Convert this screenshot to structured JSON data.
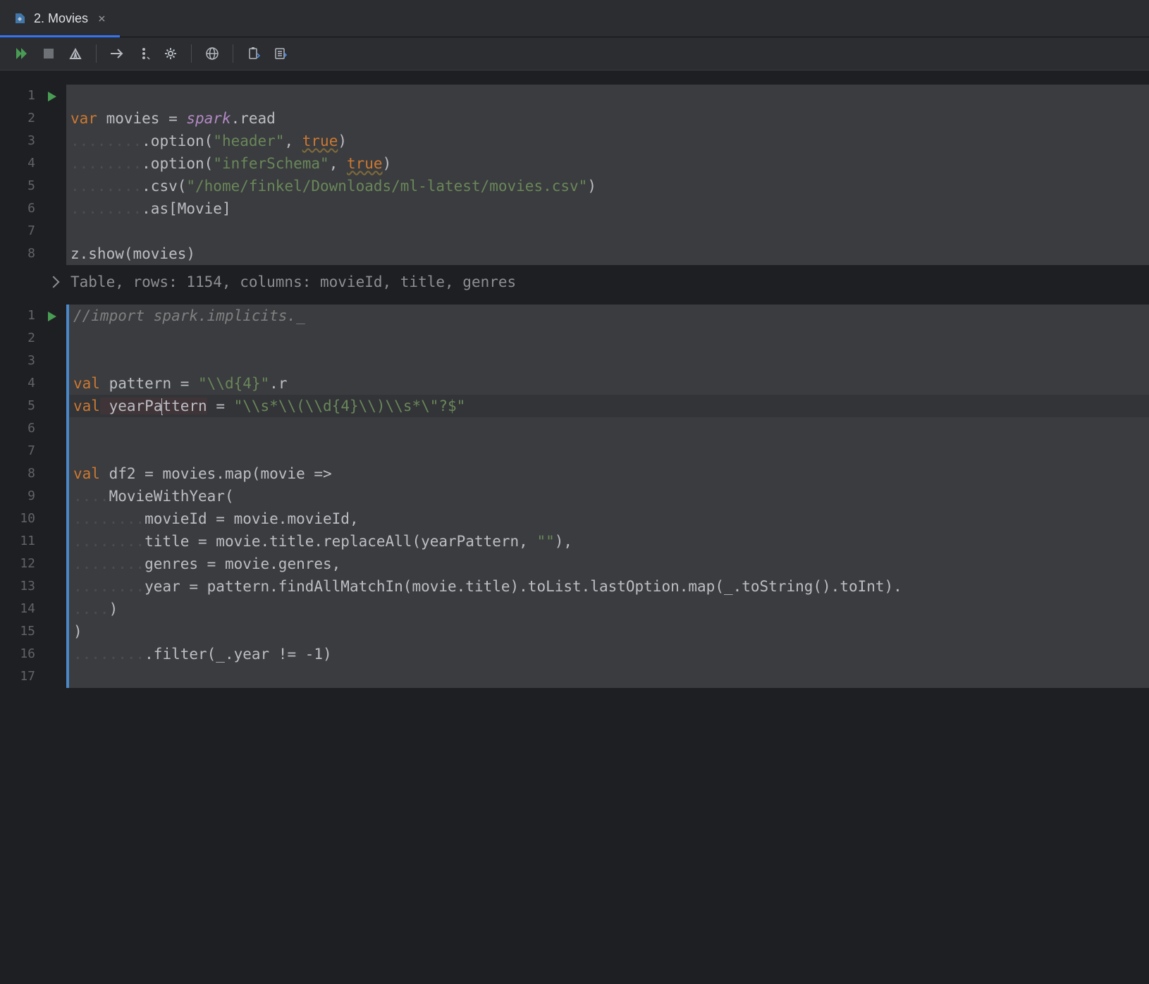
{
  "tab": {
    "title": "2. Movies"
  },
  "icons": {
    "run_all": "run-all-icon",
    "stop": "stop-icon",
    "clear": "clear-outputs-icon",
    "goto": "goto-icon",
    "more": "more-icon",
    "settings": "settings-icon",
    "browser": "browser-icon",
    "paste": "paste-icon",
    "list": "list-icon"
  },
  "cell1": {
    "lines": {
      "l1_var": "var",
      "l1_movies": " movies = ",
      "l1_spark": "spark",
      "l1_read": ".read",
      "l2_dots": "........",
      "l2_opt": ".option(",
      "l2_h": "\"header\"",
      "l2_comma": ", ",
      "l2_true": "true",
      "l2_close": ")",
      "l3_dots": "........",
      "l3_opt": ".option(",
      "l3_h": "\"inferSchema\"",
      "l3_comma": ", ",
      "l3_true": "true",
      "l3_close": ")",
      "l4_dots": "........",
      "l4_csv": ".csv(",
      "l4_path": "\"/home/finkel/Downloads/ml-latest/movies.csv\"",
      "l4_close": ")",
      "l5_dots": "........",
      "l5_as": ".as[Movie]",
      "l8": "z.show(movies)"
    },
    "output": "Table, rows: 1154, columns: movieId, title, genres"
  },
  "cell2": {
    "lines": {
      "l1_cmt": "//import spark.implicits._",
      "l4_val": "val",
      "l4_pat": " pattern = ",
      "l4_str": "\"\\\\d{4}\"",
      "l4_r": ".r",
      "l5_val": "val",
      "l5_yp_a": " yearPa",
      "l5_yp_b": "ttern",
      "l5_eq": " = ",
      "l5_str": "\"\\\\s*\\\\(\\\\d{4}\\\\)\\\\s*\\\"?$\"",
      "l8_val": "val",
      "l8_rest": " df2 = movies.map(movie =>",
      "l9_dots": "....",
      "l9_txt": "MovieWithYear(",
      "l10_dots": "........",
      "l10_txt": "movieId = movie.movieId,",
      "l11_dots": "........",
      "l11_a": "title = movie.title.replaceAll(yearPattern, ",
      "l11_s": "\"\"",
      "l11_b": "),",
      "l12_dots": "........",
      "l12_txt": "genres = movie.genres,",
      "l13_dots": "........",
      "l13_txt": "year = pattern.findAllMatchIn(movie.title).toList.lastOption.map(_.toString().toInt).",
      "l14_dots": "....",
      "l14_txt": ")",
      "l15_txt": ")",
      "l16_dots": "........",
      "l16_txt": ".filter(_.year != -",
      "l16_num": "1",
      "l16_cl": ")"
    }
  }
}
